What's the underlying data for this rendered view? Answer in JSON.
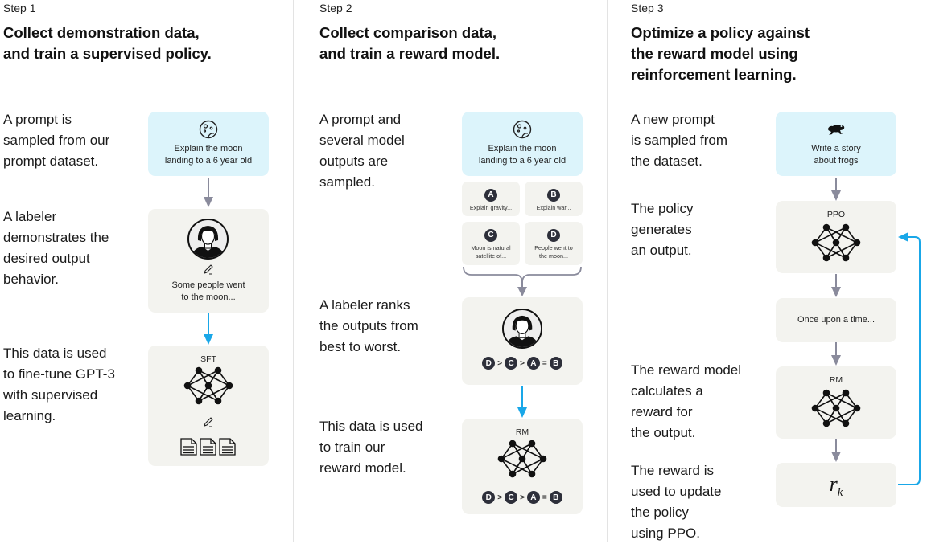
{
  "steps": [
    {
      "label": "Step 1",
      "title_lines": [
        "Collect demonstration data,",
        "and train a supervised policy."
      ],
      "descriptions": [
        [
          "A prompt is",
          "sampled from our",
          "prompt dataset."
        ],
        [
          "A labeler",
          "demonstrates the",
          "desired output",
          "behavior."
        ],
        [
          "This data is used",
          "to fine-tune GPT-3",
          "with supervised",
          "learning."
        ]
      ],
      "prompt_box": {
        "icon": "moon-icon",
        "lines": [
          "Explain the moon",
          "landing to a 6 year old"
        ]
      },
      "labeler_box": {
        "icon": "labeler-avatar",
        "edit_icon": "pencil-icon",
        "lines": [
          "Some people went",
          "to the moon..."
        ]
      },
      "model_box": {
        "label": "SFT",
        "icon": "neural-network-icon",
        "edit_icon": "pencil-icon",
        "docs_icon": "documents-icon"
      }
    },
    {
      "label": "Step 2",
      "title_lines": [
        "Collect comparison data,",
        "and train a reward model."
      ],
      "descriptions": [
        [
          "A prompt and",
          "several model",
          "outputs are",
          "sampled."
        ],
        [
          "A labeler ranks",
          "the outputs from",
          "best to worst."
        ],
        [
          "This data is used",
          "to train our",
          "reward model."
        ]
      ],
      "prompt_box": {
        "icon": "moon-icon",
        "lines": [
          "Explain the moon",
          "landing to a 6 year old"
        ]
      },
      "outputs": [
        {
          "badge": "A",
          "lines": [
            "Explain gravity..."
          ]
        },
        {
          "badge": "B",
          "lines": [
            "Explain war..."
          ]
        },
        {
          "badge": "C",
          "lines": [
            "Moon is natural",
            "satellite of..."
          ]
        },
        {
          "badge": "D",
          "lines": [
            "People went to",
            "the moon..."
          ]
        }
      ],
      "ranking": {
        "items": [
          "D",
          "C",
          "A",
          "B"
        ],
        "ops": [
          ">",
          ">",
          "="
        ]
      },
      "model_box": {
        "label": "RM",
        "icon": "neural-network-icon"
      }
    },
    {
      "label": "Step 3",
      "title_lines": [
        "Optimize a policy against",
        "the reward model using",
        "reinforcement learning."
      ],
      "descriptions": [
        [
          "A new prompt",
          "is sampled from",
          "the dataset."
        ],
        [
          "The policy",
          "generates",
          "an output."
        ],
        [
          "The reward model",
          "calculates a",
          "reward for",
          "the output."
        ],
        [
          "The reward is",
          "used to update",
          "the policy",
          "using PPO."
        ]
      ],
      "prompt_box": {
        "icon": "frog-icon",
        "lines": [
          "Write a story",
          "about frogs"
        ]
      },
      "policy_box": {
        "label": "PPO",
        "icon": "neural-network-icon"
      },
      "output_box": {
        "lines": [
          "Once upon a time..."
        ]
      },
      "rm_box": {
        "label": "RM",
        "icon": "neural-network-icon"
      },
      "reward_box": {
        "symbol": "r",
        "subscript": "k"
      }
    }
  ],
  "colors": {
    "prompt_bg": "#dcf4fb",
    "box_bg": "#f3f3ef",
    "gray_arrow": "#8a8b9c",
    "blue_arrow": "#19a7e8",
    "badge_bg": "#2d2f3a"
  }
}
